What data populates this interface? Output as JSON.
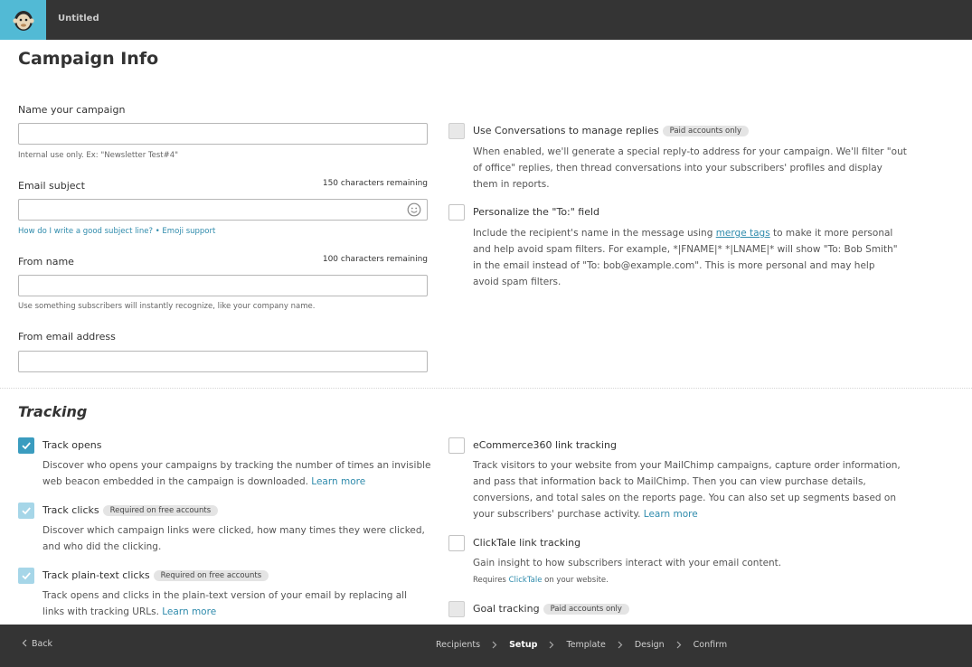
{
  "header": {
    "title": "Untitled",
    "logo_icon": "mailchimp-logo"
  },
  "page": {
    "title": "Campaign Info"
  },
  "form": {
    "name": {
      "label": "Name your campaign",
      "value": "",
      "help": "Internal use only. Ex: \"Newsletter Test#4\""
    },
    "subject": {
      "label": "Email subject",
      "counter": "150 characters remaining",
      "value": "",
      "help_link1": "How do I write a good subject line?",
      "help_sep": " • ",
      "help_link2": "Emoji support",
      "emoji_icon": "smiley-icon"
    },
    "from_name": {
      "label": "From name",
      "counter": "100 characters remaining",
      "value": "",
      "help": "Use something subscribers will instantly recognize, like your company name."
    },
    "from_email": {
      "label": "From email address",
      "value": ""
    }
  },
  "options": {
    "conversations": {
      "title": "Use Conversations to manage replies",
      "badge": "Paid accounts only",
      "desc": "When enabled, we'll generate a special reply-to address for your campaign. We'll filter \"out of office\" replies, then thread conversations into your subscribers' profiles and display them in reports."
    },
    "personalize": {
      "title": "Personalize the \"To:\" field",
      "desc_a": "Include the recipient's name in the message using ",
      "desc_link": "merge tags",
      "desc_b": " to make it more personal and help avoid spam filters. For example, *|FNAME|* *|LNAME|* will show \"To: Bob Smith\" in the email instead of \"To: bob@example.com\". This is more personal and may help avoid spam filters."
    }
  },
  "tracking": {
    "title": "Tracking",
    "opens": {
      "title": "Track opens",
      "checked": true,
      "desc": "Discover who opens your campaigns by tracking the number of times an invisible web beacon embedded in the campaign is downloaded. ",
      "link": "Learn more"
    },
    "clicks": {
      "title": "Track clicks",
      "badge": "Required on free accounts",
      "checked": true,
      "desc": "Discover which campaign links were clicked, how many times they were clicked, and who did the clicking."
    },
    "plaintext": {
      "title": "Track plain-text clicks",
      "badge": "Required on free accounts",
      "checked": true,
      "desc": "Track opens and clicks in the plain-text version of your email by replacing all links with tracking URLs. ",
      "link": "Learn more"
    },
    "ecommerce": {
      "title": "eCommerce360 link tracking",
      "checked": false,
      "desc": "Track visitors to your website from your MailChimp campaigns, capture order information, and pass that information back to MailChimp. Then you can view purchase details, conversions, and total sales on the reports page. You can also set up segments based on your subscribers' purchase activity. ",
      "link": "Learn more"
    },
    "clicktale": {
      "title": "ClickTale link tracking",
      "checked": false,
      "desc": "Gain insight to how subscribers interact with your email content.",
      "req_a": "Requires ",
      "req_link": "ClickTale",
      "req_b": " on your website."
    },
    "goal": {
      "title": "Goal tracking",
      "badge": "Paid accounts only",
      "checked": false
    }
  },
  "footer": {
    "back": "Back",
    "steps": [
      "Recipients",
      "Setup",
      "Template",
      "Design",
      "Confirm"
    ],
    "active_step": "Setup"
  }
}
